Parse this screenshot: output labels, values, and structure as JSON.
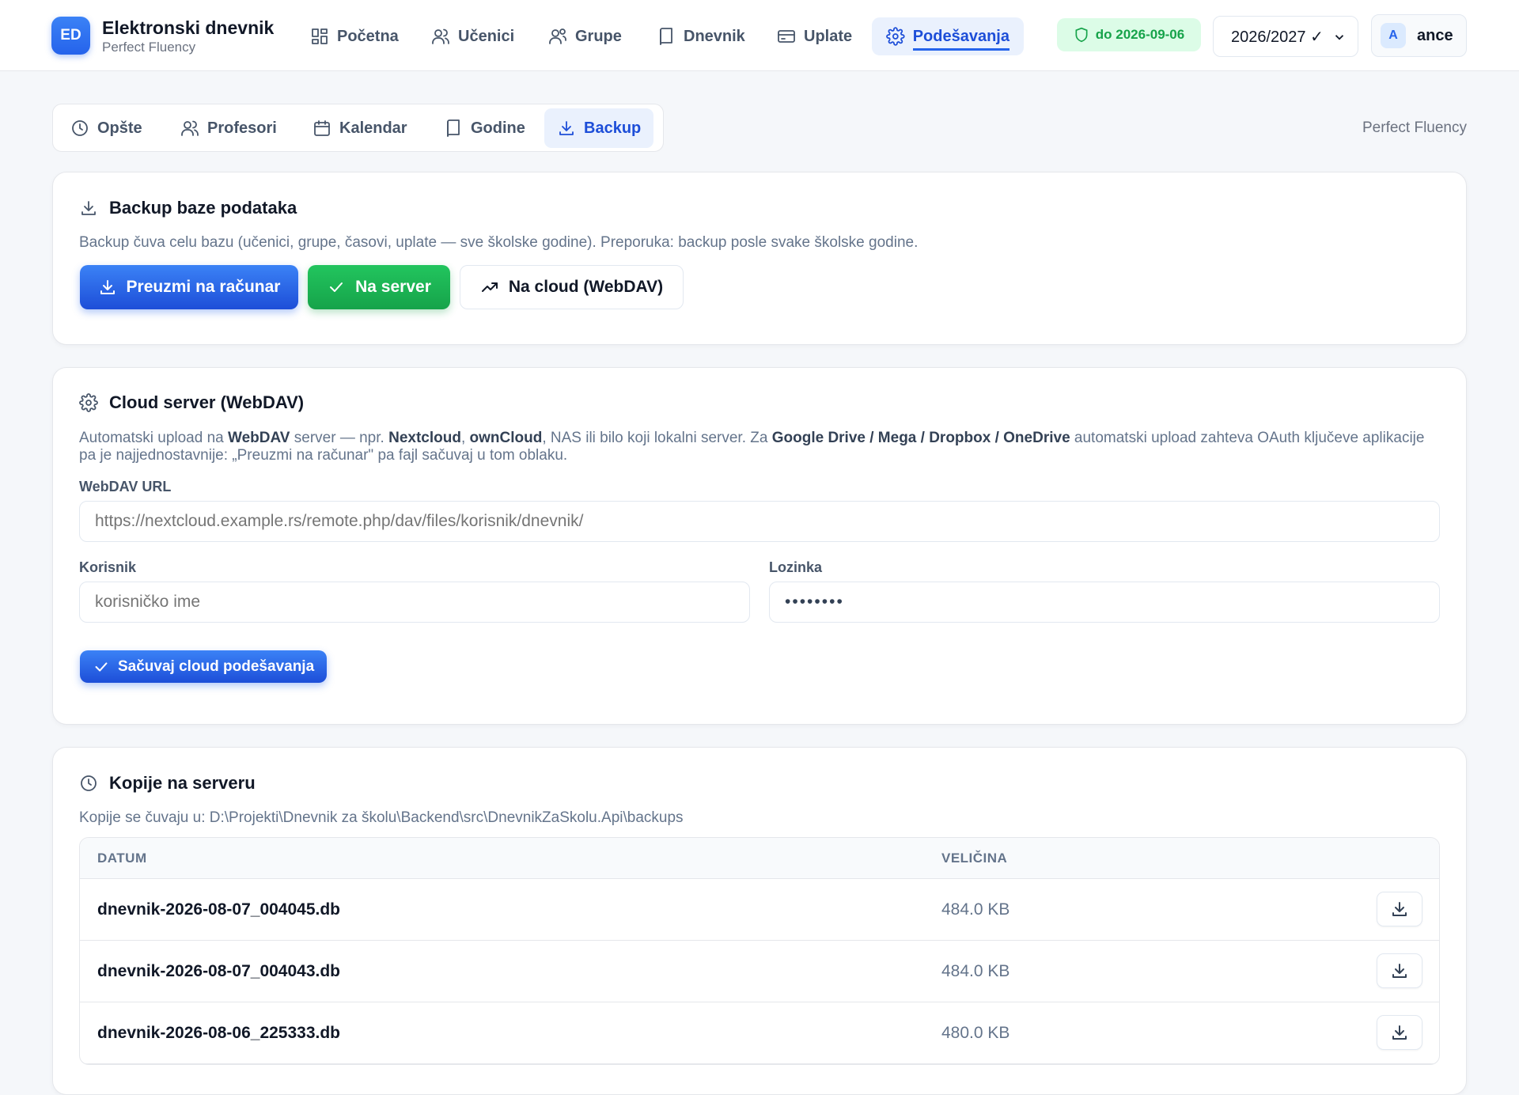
{
  "app": {
    "logo": "ED",
    "title": "Elektronski dnevnik",
    "subtitle": "Perfect Fluency"
  },
  "nav": {
    "items": [
      {
        "label": "Početna",
        "icon": "dashboard-icon"
      },
      {
        "label": "Učenici",
        "icon": "users-icon"
      },
      {
        "label": "Grupe",
        "icon": "users-group-icon"
      },
      {
        "label": "Dnevnik",
        "icon": "book-icon"
      },
      {
        "label": "Uplate",
        "icon": "credit-card-icon"
      },
      {
        "label": "Podešavanja",
        "icon": "gear-icon",
        "active": true
      }
    ]
  },
  "header": {
    "license_badge": "do 2026-09-06",
    "year_select": "2026/2027 ✓",
    "user_initial": "A",
    "user_name": "ance"
  },
  "subtabs": {
    "items": [
      {
        "label": "Opšte",
        "icon": "clock-icon"
      },
      {
        "label": "Profesori",
        "icon": "users-icon"
      },
      {
        "label": "Kalendar",
        "icon": "calendar-icon"
      },
      {
        "label": "Godine",
        "icon": "book-icon"
      },
      {
        "label": "Backup",
        "icon": "download-icon",
        "active": true
      }
    ],
    "org_name": "Perfect Fluency"
  },
  "backup": {
    "title": "Backup baze podataka",
    "description": "Backup čuva celu bazu (učenici, grupe, časovi, uplate — sve školske godine). Preporuka: backup posle svake školske godine.",
    "btn_download": "Preuzmi na računar",
    "btn_server": "Na server",
    "btn_cloud": "Na cloud (WebDAV)"
  },
  "cloud": {
    "title": "Cloud server (WebDAV)",
    "desc_1": "Automatski upload na ",
    "desc_b1": "WebDAV",
    "desc_2": " server — npr. ",
    "desc_b2": "Nextcloud",
    "desc_3": ", ",
    "desc_b3": "ownCloud",
    "desc_4": ", NAS ili bilo koji lokalni server. Za ",
    "desc_b4": "Google Drive / Mega / Dropbox / OneDrive",
    "desc_5": " automatski upload zahteva OAuth ključeve aplikacije pa je najjednostavnije: „Preuzmi na računar\" pa fajl sačuvaj u tom oblaku.",
    "url_label": "WebDAV URL",
    "url_placeholder": "https://nextcloud.example.rs/remote.php/dav/files/korisnik/dnevnik/",
    "user_label": "Korisnik",
    "user_placeholder": "korisničko ime",
    "password_label": "Lozinka",
    "password_value": "••••••••",
    "save_btn": "Sačuvaj cloud podešavanja"
  },
  "copies": {
    "title": "Kopije na serveru",
    "path_text": "Kopije se čuvaju u: D:\\Projekti\\Dnevnik za školu\\Backend\\src\\DnevnikZaSkolu.Api\\backups",
    "col_date": "DATUM",
    "col_size": "VELIČINA",
    "rows": [
      {
        "name": "dnevnik-2026-08-07_004045.db",
        "size": "484.0 KB"
      },
      {
        "name": "dnevnik-2026-08-07_004043.db",
        "size": "484.0 KB"
      },
      {
        "name": "dnevnik-2026-08-06_225333.db",
        "size": "480.0 KB"
      }
    ]
  },
  "colors": {
    "accent": "#2563eb",
    "success": "#16a34a",
    "background": "#f5f7fa"
  }
}
